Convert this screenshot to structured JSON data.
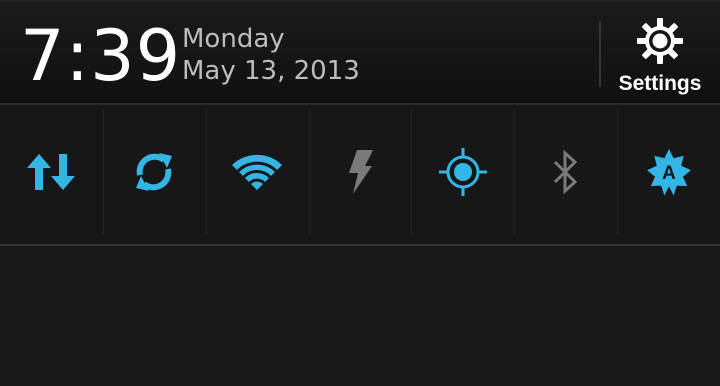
{
  "status": {
    "time": "7:39",
    "day": "Monday",
    "date": "May 13, 2013"
  },
  "settings": {
    "label": "Settings",
    "icon": "gear-icon"
  },
  "toggles": [
    {
      "id": "mobile-data",
      "icon": "data-arrows-icon",
      "state": "on"
    },
    {
      "id": "sync",
      "icon": "sync-icon",
      "state": "on"
    },
    {
      "id": "wifi",
      "icon": "wifi-icon",
      "state": "on"
    },
    {
      "id": "flashlight",
      "icon": "flash-icon",
      "state": "off"
    },
    {
      "id": "gps",
      "icon": "gps-icon",
      "state": "on"
    },
    {
      "id": "bluetooth",
      "icon": "bluetooth-icon",
      "state": "off"
    },
    {
      "id": "auto-brightness",
      "icon": "brightness-auto-icon",
      "state": "on"
    }
  ],
  "colors": {
    "active": "#33b5e5",
    "inactive": "#7a7a7a"
  }
}
